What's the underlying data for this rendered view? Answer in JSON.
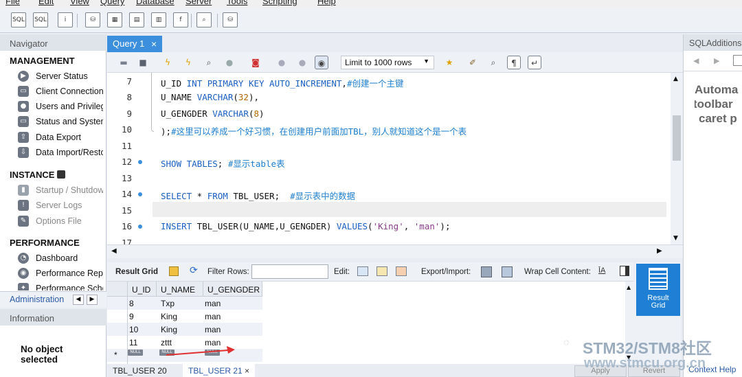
{
  "menubar": {
    "items": [
      "File",
      "Edit",
      "View",
      "Query",
      "Database",
      "Server",
      "Tools",
      "Scripting",
      "Help"
    ]
  },
  "navigator": {
    "title": "Navigator",
    "management": {
      "title": "MANAGEMENT",
      "items": [
        "Server Status",
        "Client Connections",
        "Users and Privileges",
        "Status and System Variables",
        "Data Export",
        "Data Import/Restore"
      ]
    },
    "instance": {
      "title": "INSTANCE",
      "items": [
        "Startup / Shutdown",
        "Server Logs",
        "Options File"
      ]
    },
    "performance": {
      "title": "PERFORMANCE",
      "items": [
        "Dashboard",
        "Performance Reports",
        "Performance Schema Setup"
      ]
    },
    "tabs": {
      "active": "Administration"
    }
  },
  "information": {
    "title": "Information",
    "message": "No object selected"
  },
  "query_tab": {
    "label": "Query 1",
    "close": "×"
  },
  "editor_toolbar": {
    "limit_label": "Limit to 1000 rows"
  },
  "editor": {
    "lines": [
      {
        "num": "7",
        "dot": false
      },
      {
        "num": "8",
        "dot": false
      },
      {
        "num": "9",
        "dot": false
      },
      {
        "num": "10",
        "dot": false
      },
      {
        "num": "11",
        "dot": false
      },
      {
        "num": "12",
        "dot": true
      },
      {
        "num": "13",
        "dot": false
      },
      {
        "num": "14",
        "dot": true
      },
      {
        "num": "15",
        "dot": false
      },
      {
        "num": "16",
        "dot": true
      },
      {
        "num": "17",
        "dot": false
      }
    ],
    "code": {
      "l7": [
        "U_ID ",
        "INT PRIMARY KEY AUTO_INCREMENT",
        ",",
        "#创建一个主键"
      ],
      "l8": [
        "U_NAME ",
        "VARCHAR",
        "(",
        "32",
        "),"
      ],
      "l9": [
        "U_GENGDER ",
        "VARCHAR",
        "(",
        "8",
        ")"
      ],
      "l10": [
        ");",
        "#这里可以养成一个好习惯，在创建用户前面加TBL，别人就知道这个是一个表"
      ],
      "l12": [
        "SHOW TABLES",
        "; ",
        "#显示table表"
      ],
      "l14": [
        "SELECT",
        " * ",
        "FROM",
        " TBL_USER;  ",
        "#显示表中的数据"
      ],
      "l16": [
        "INSERT",
        " TBL_USER(U_NAME,U_GENGDER) ",
        "VALUES",
        "(",
        "'King'",
        ", ",
        "'man'",
        ");"
      ]
    }
  },
  "result_toolbar": {
    "result_grid": "Result Grid",
    "filter_rows": "Filter Rows:",
    "filter_value": "",
    "edit": "Edit:",
    "export_import": "Export/Import:",
    "wrap": "Wrap Cell Content:"
  },
  "grid": {
    "columns": [
      "U_ID",
      "U_NAME",
      "U_GENGDER"
    ],
    "rows": [
      [
        "8",
        "Txp",
        "man"
      ],
      [
        "9",
        "King",
        "man"
      ],
      [
        "10",
        "King",
        "man"
      ],
      [
        "11",
        "zttt",
        "man"
      ]
    ],
    "null_label": "NULL",
    "new_row_marker": "*"
  },
  "result_side": {
    "label_1": "Result",
    "label_2": "Grid"
  },
  "bottom_tabs": [
    {
      "label": "TBL_USER 20"
    },
    {
      "label": "TBL_USER 21",
      "close": "×"
    }
  ],
  "buttons": {
    "apply": "Apply",
    "revert": "Revert"
  },
  "sqladditions": {
    "title": "SQLAdditions",
    "text_lines": [
      "Automa",
      "toolbar",
      "caret p"
    ],
    "context_help": "Context Help"
  },
  "watermark": {
    "line1": "STM32/STM8社区",
    "line2": "www.stmcu.org.cn"
  },
  "colors": {
    "accent": "#3c8fdc",
    "keyword": "#1a5fc4",
    "comment": "#1e7fcf",
    "arrow": "#e03030"
  }
}
